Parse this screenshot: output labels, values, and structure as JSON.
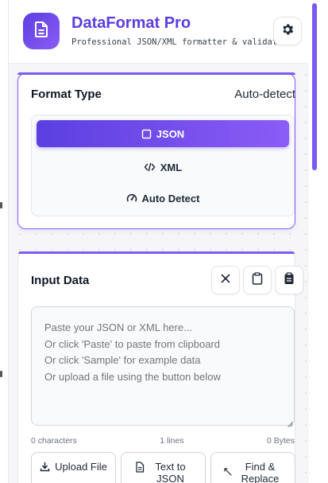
{
  "header": {
    "title": "DataFormat Pro",
    "subtitle": "Professional JSON/XML formatter & validator",
    "settings_icon": "gear-icon",
    "logo_icon": "document-icon"
  },
  "format": {
    "title": "Format Type",
    "status": "Auto-detect",
    "options": [
      {
        "label": "JSON",
        "icon": "square-icon",
        "active": true
      },
      {
        "label": "XML",
        "icon": "code-icon",
        "active": false
      },
      {
        "label": "Auto Detect",
        "icon": "gauge-icon",
        "active": false
      }
    ]
  },
  "input": {
    "title": "Input Data",
    "placeholder": "Paste your JSON or XML here...\nOr click 'Paste' to paste from clipboard\nOr click 'Sample' for example data\nOr upload a file using the button below",
    "stats": {
      "characters": "0 characters",
      "lines": "1 lines",
      "bytes": "0 Bytes"
    },
    "actions": {
      "upload": "Upload File",
      "text_to_json": "Text to JSON",
      "find_replace": "Find & Replace"
    }
  },
  "colors": {
    "accent": "#5b3fe0",
    "accent_light": "#8b5cf6"
  }
}
